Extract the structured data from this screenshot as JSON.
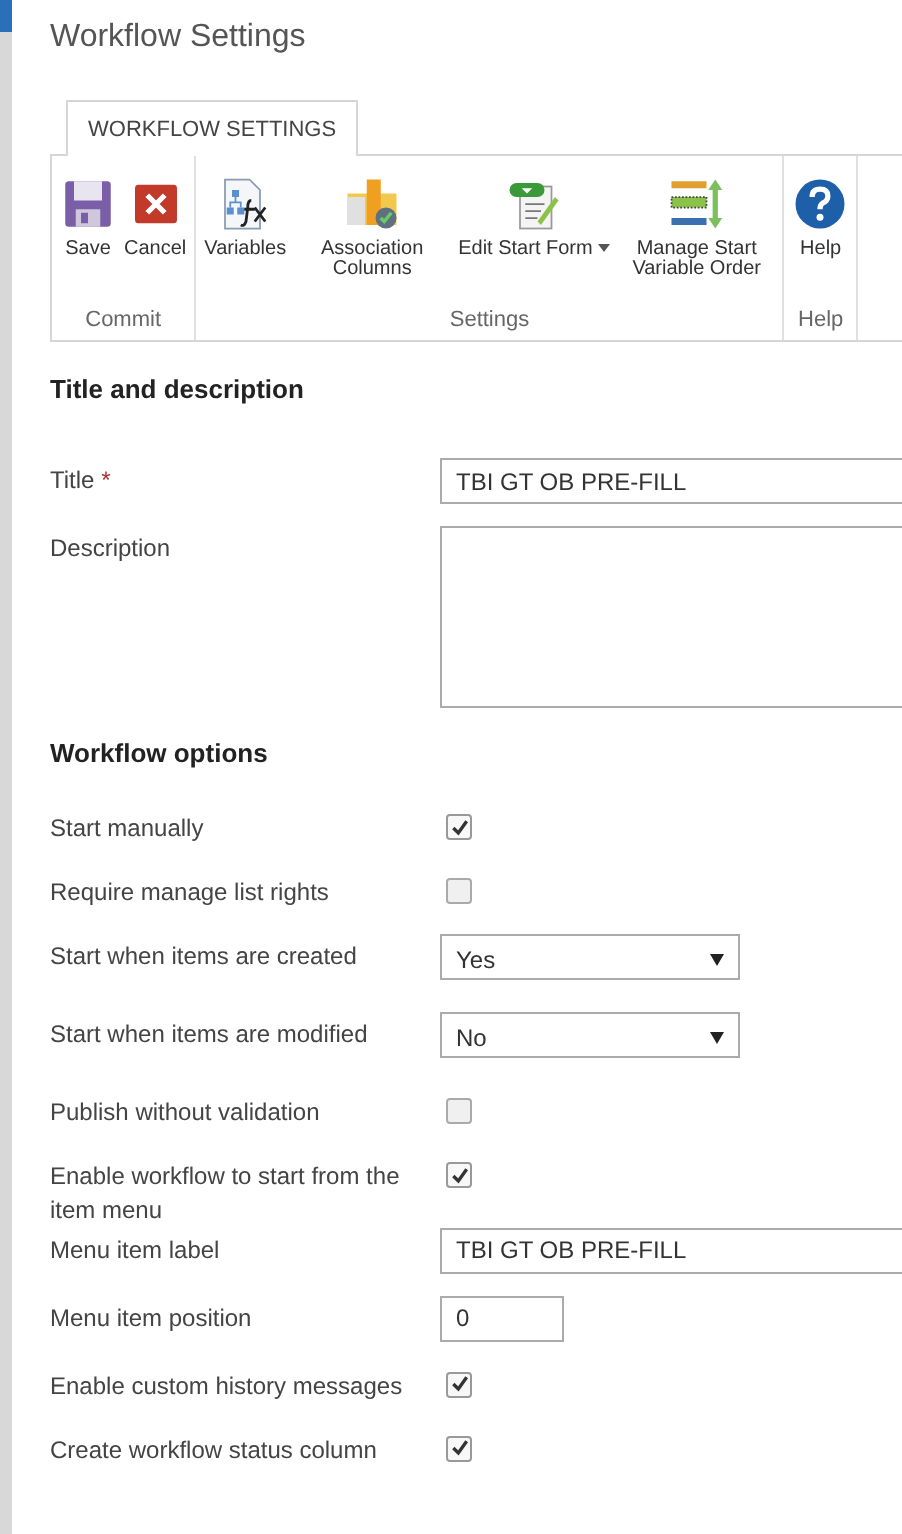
{
  "page_title": "Workflow Settings",
  "ribbon": {
    "tabs": [
      {
        "label": "WORKFLOW SETTINGS",
        "selected": true
      }
    ],
    "groups": [
      {
        "label": "Commit",
        "buttons": [
          {
            "label": "Save",
            "kind": "save"
          },
          {
            "label": "Cancel",
            "kind": "cancel"
          }
        ]
      },
      {
        "label": "Settings",
        "buttons": [
          {
            "label": "Variables",
            "kind": "variables"
          },
          {
            "label": "Association Columns",
            "kind": "columns"
          },
          {
            "label": "Edit Start Form",
            "kind": "form",
            "dropdown": true
          },
          {
            "label": "Manage Start Variable Order",
            "kind": "order"
          }
        ]
      },
      {
        "label": "Help",
        "buttons": [
          {
            "label": "Help",
            "kind": "help"
          }
        ]
      }
    ]
  },
  "title_section": {
    "heading": "Title and description",
    "title": {
      "label": "Title",
      "required_mark": "*",
      "value": "TBI GT OB PRE-FILL"
    },
    "description": {
      "label": "Description"
    }
  },
  "options_section": {
    "heading": "Workflow options",
    "rows": [
      {
        "kind": "checkbox",
        "label": "Start manually",
        "checked": true
      },
      {
        "kind": "checkbox",
        "label": "Require manage list rights",
        "checked": false
      },
      {
        "kind": "select",
        "label": "Start when items are created",
        "value": "Yes"
      },
      {
        "kind": "select",
        "label": "Start when items are modified",
        "value": "No"
      },
      {
        "kind": "checkbox",
        "label": "Publish without validation",
        "checked": false
      },
      {
        "kind": "checkbox",
        "label": "Enable workflow to start from the item menu",
        "checked": true
      },
      {
        "kind": "text",
        "label": "Menu item label",
        "value": "TBI GT OB PRE-FILL"
      },
      {
        "kind": "short",
        "label": "Menu item position",
        "value": "0"
      },
      {
        "kind": "checkbox",
        "label": "Enable custom history messages",
        "checked": true
      },
      {
        "kind": "checkbox",
        "label": "Create workflow status column",
        "checked": true
      }
    ]
  }
}
